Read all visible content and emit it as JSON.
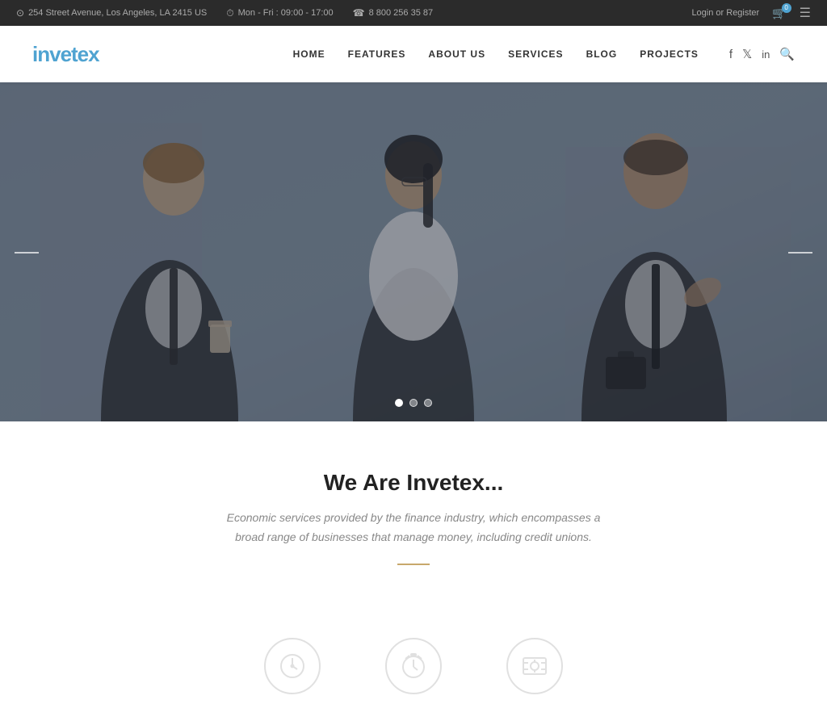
{
  "topbar": {
    "address": "254 Street Avenue, Los Angeles, LA 2415 US",
    "hours": "Mon - Fri : 09:00 - 17:00",
    "phone": "8 800 256 35 87",
    "login": "Login or Register",
    "cart_count": "0"
  },
  "header": {
    "logo_text": "invetex",
    "nav_items": [
      {
        "label": "HOME",
        "id": "home"
      },
      {
        "label": "FEATURES",
        "id": "features"
      },
      {
        "label": "ABOUT US",
        "id": "about"
      },
      {
        "label": "SERVICES",
        "id": "services"
      },
      {
        "label": "BLOG",
        "id": "blog"
      },
      {
        "label": "PROJECTS",
        "id": "projects"
      }
    ]
  },
  "hero": {
    "arrow_left": "←",
    "arrow_right": "→",
    "dots": [
      {
        "active": true
      },
      {
        "active": false
      },
      {
        "active": false
      }
    ]
  },
  "intro": {
    "title": "We Are Invetex...",
    "description": "Economic services provided by the finance industry, which encompasses a broad range of businesses that manage money, including credit unions.",
    "divider": true
  },
  "icons": [
    {
      "symbol": "🕐",
      "id": "clock-icon"
    },
    {
      "symbol": "⏰",
      "id": "alarm-icon"
    },
    {
      "symbol": "💵",
      "id": "money-icon"
    }
  ]
}
